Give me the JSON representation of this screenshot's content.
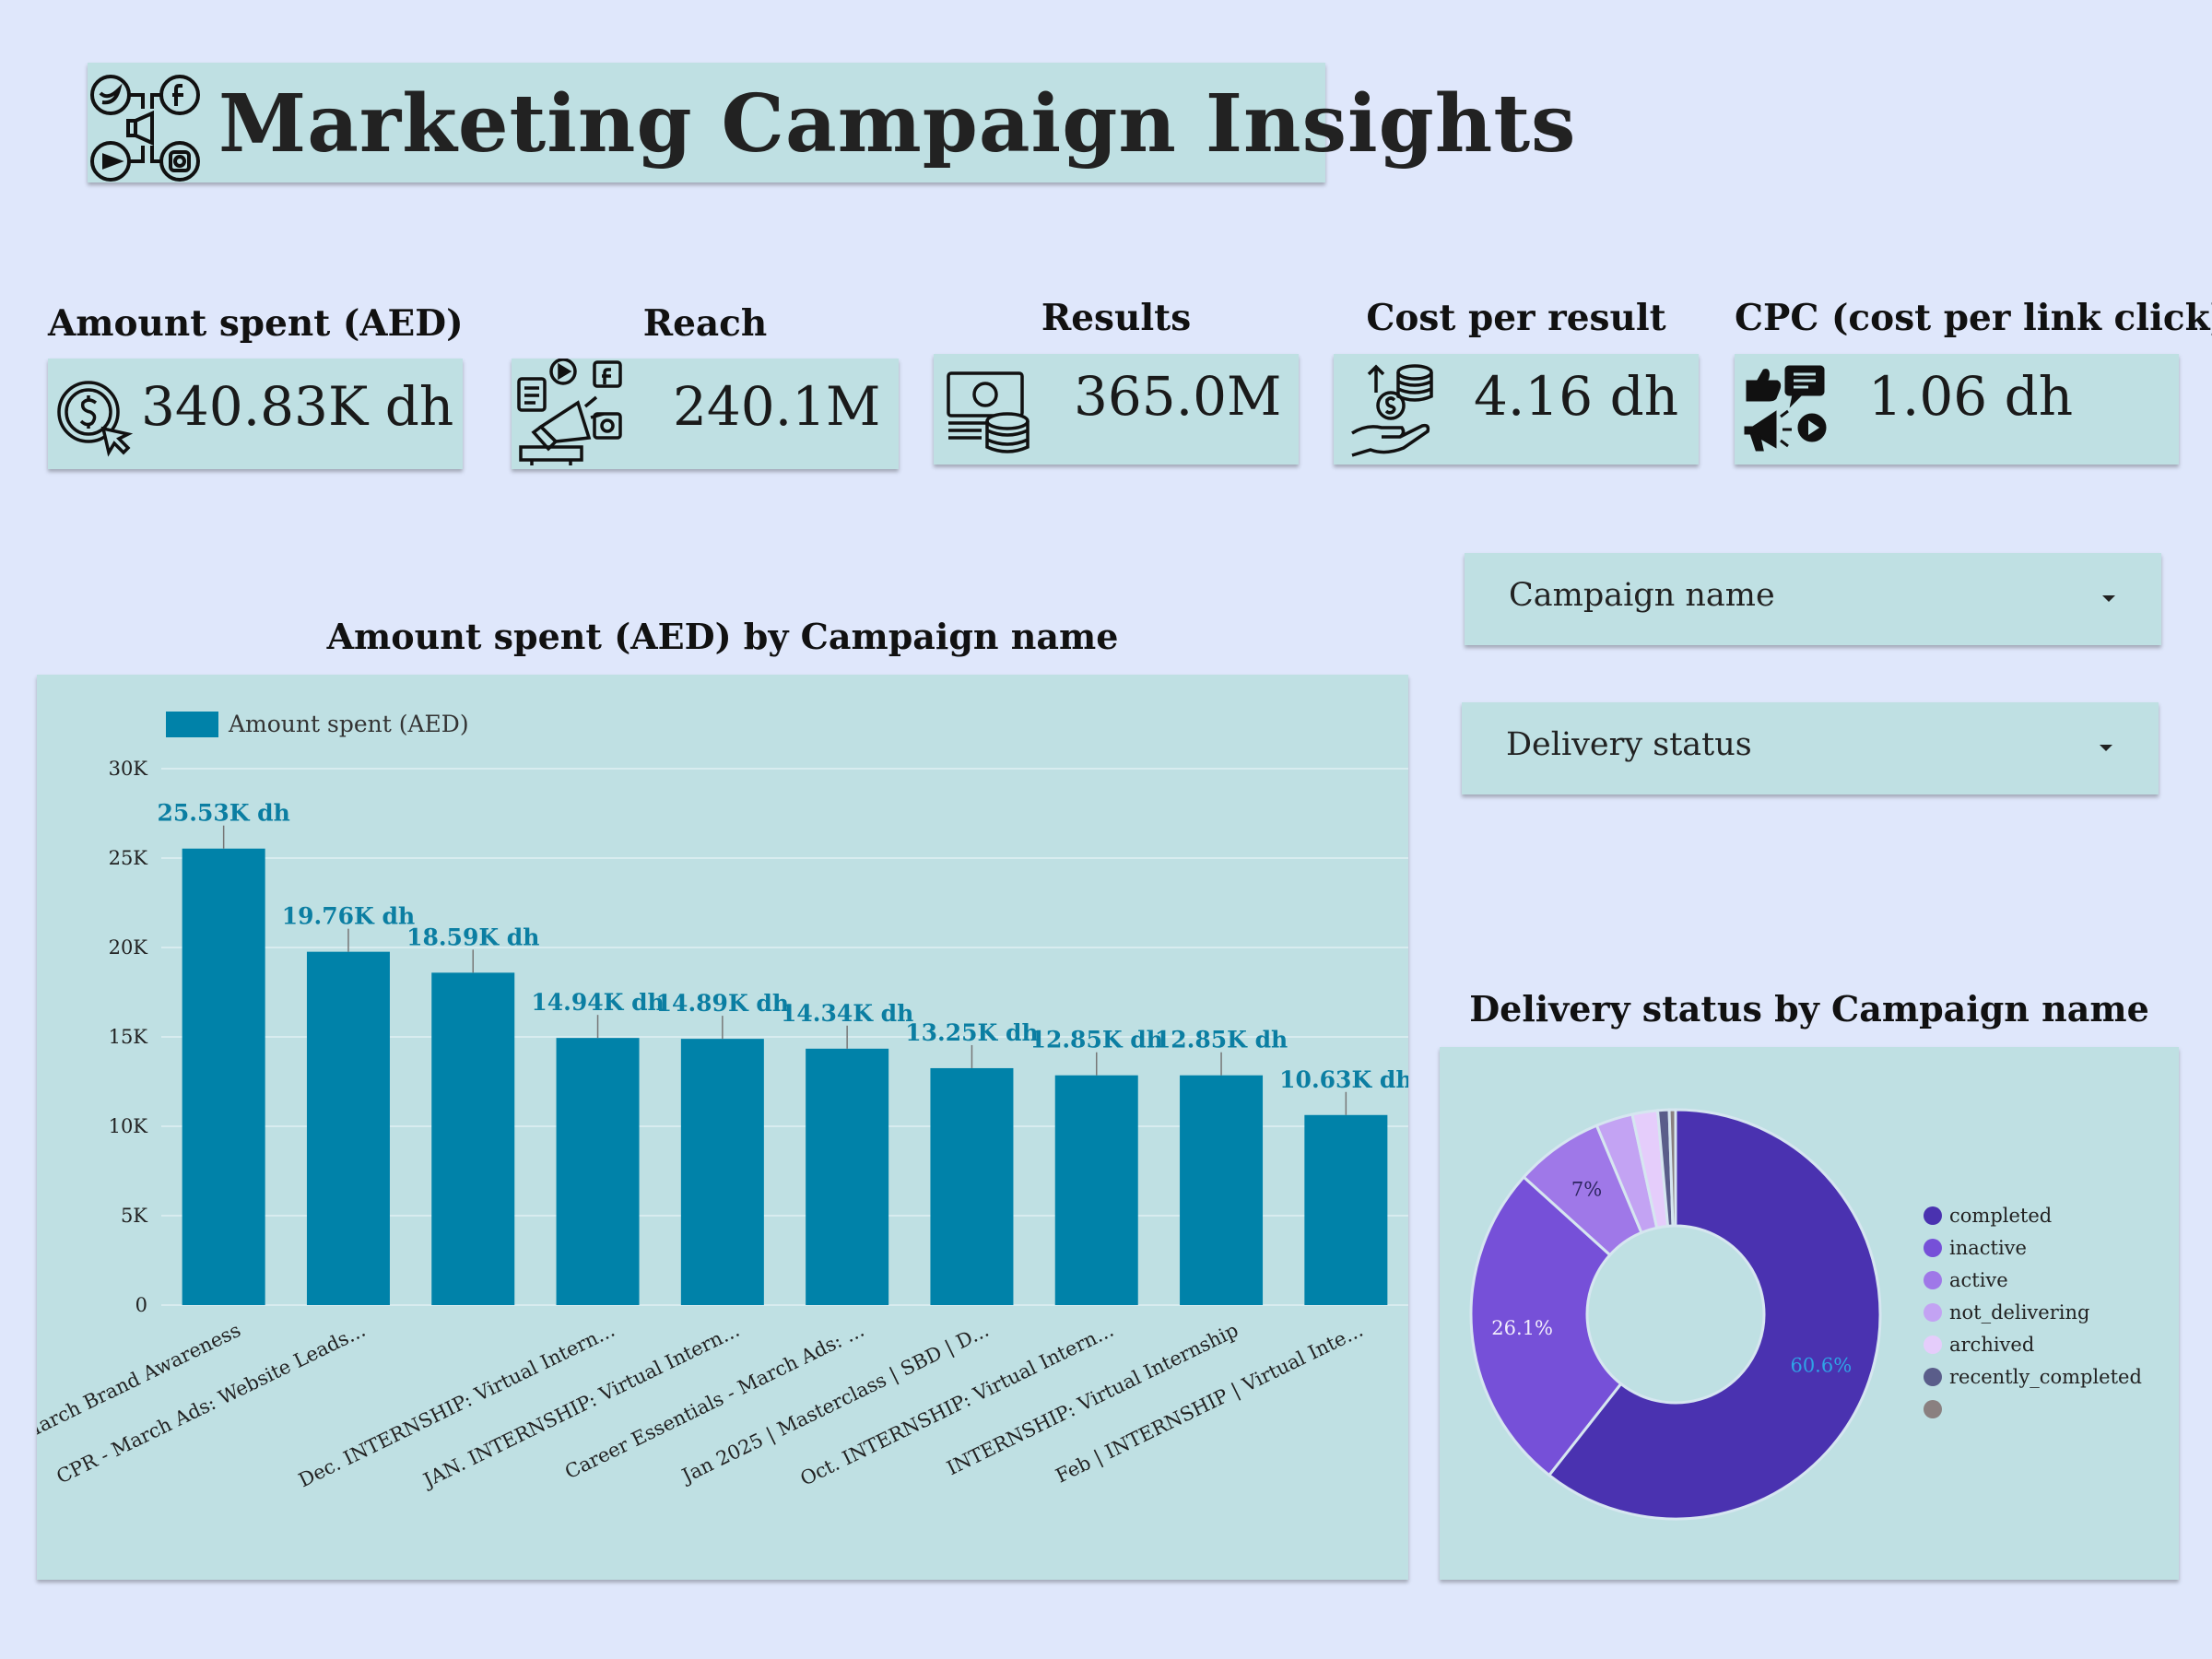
{
  "header": {
    "title": "Marketing Campaign Insights"
  },
  "kpis": [
    {
      "label": "Amount spent (AED)",
      "value": "340.83K dh",
      "icon": "dollar-click-icon"
    },
    {
      "label": "Reach",
      "value": "240.1M",
      "icon": "megaphone-social-icon"
    },
    {
      "label": "Results",
      "value": "365.0M",
      "icon": "cash-coins-icon"
    },
    {
      "label": "Cost per result",
      "value": "4.16 dh",
      "icon": "hand-coins-icon"
    },
    {
      "label": "CPC (cost per link click)",
      "value": "1.06 dh",
      "icon": "like-play-megaphone-icon"
    }
  ],
  "filters": {
    "campaign_label": "Campaign name",
    "delivery_label": "Delivery status"
  },
  "colors": {
    "background": "#dfe7fb",
    "panel": "#bfe0e3",
    "bar": "#0082a9",
    "bar_label": "#0b7ea2"
  },
  "chart_data": [
    {
      "type": "bar",
      "title": "Amount spent (AED) by Campaign name",
      "legend": [
        "Amount spent (AED)"
      ],
      "legend_position": "top-left",
      "grid": true,
      "ylim": [
        0,
        30000
      ],
      "yticks": [
        "0",
        "5K",
        "10K",
        "15K",
        "20K",
        "25K",
        "30K"
      ],
      "ytick_values": [
        0,
        5000,
        10000,
        15000,
        20000,
        25000,
        30000
      ],
      "categories": [
        "March Brand Awareness",
        "CPR - March Ads: Website Leads...",
        "Dec. INTERNSHIP: Virtual Intern...",
        "JAN. INTERNSHIP: Virtual Intern...",
        "Career Essentials - March Ads: ...",
        "Jan 2025 | Masterclass | SBD | D...",
        "Oct. INTERNSHIP: Virtual Intern...",
        "INTERNSHIP: Virtual Internship",
        "Feb | INTERNSHIP | Virtual Inte..."
      ],
      "tick_label_slots": [
        0,
        1,
        3,
        4,
        5,
        6,
        7,
        8,
        9
      ],
      "series": [
        {
          "name": "Amount spent (AED)",
          "values": [
            25530,
            19760,
            18590,
            14940,
            14890,
            14340,
            13250,
            12850,
            12850,
            10630
          ],
          "labels": [
            "25.53K dh",
            "19.76K dh",
            "18.59K dh",
            "14.94K dh",
            "14.89K dh",
            "14.34K dh",
            "13.25K dh",
            "12.85K dh",
            "12.85K dh",
            "10.63K dh"
          ]
        }
      ]
    },
    {
      "type": "pie",
      "title": "Delivery status by Campaign name",
      "donut": true,
      "legend_position": "right",
      "categories": [
        "completed",
        "inactive",
        "active",
        "not_delivering",
        "archived",
        "recently_completed",
        ""
      ],
      "values": [
        60.6,
        26.1,
        7.0,
        2.9,
        2.0,
        0.9,
        0.5
      ],
      "slice_labels": [
        "60.6%",
        "26.1%",
        "7%",
        "",
        "",
        "",
        ""
      ],
      "colors": [
        "#4a32b0",
        "#7650d8",
        "#9f78e8",
        "#c3a3f3",
        "#e5cdfb",
        "#5a5d8a",
        "#8a8080"
      ]
    }
  ]
}
